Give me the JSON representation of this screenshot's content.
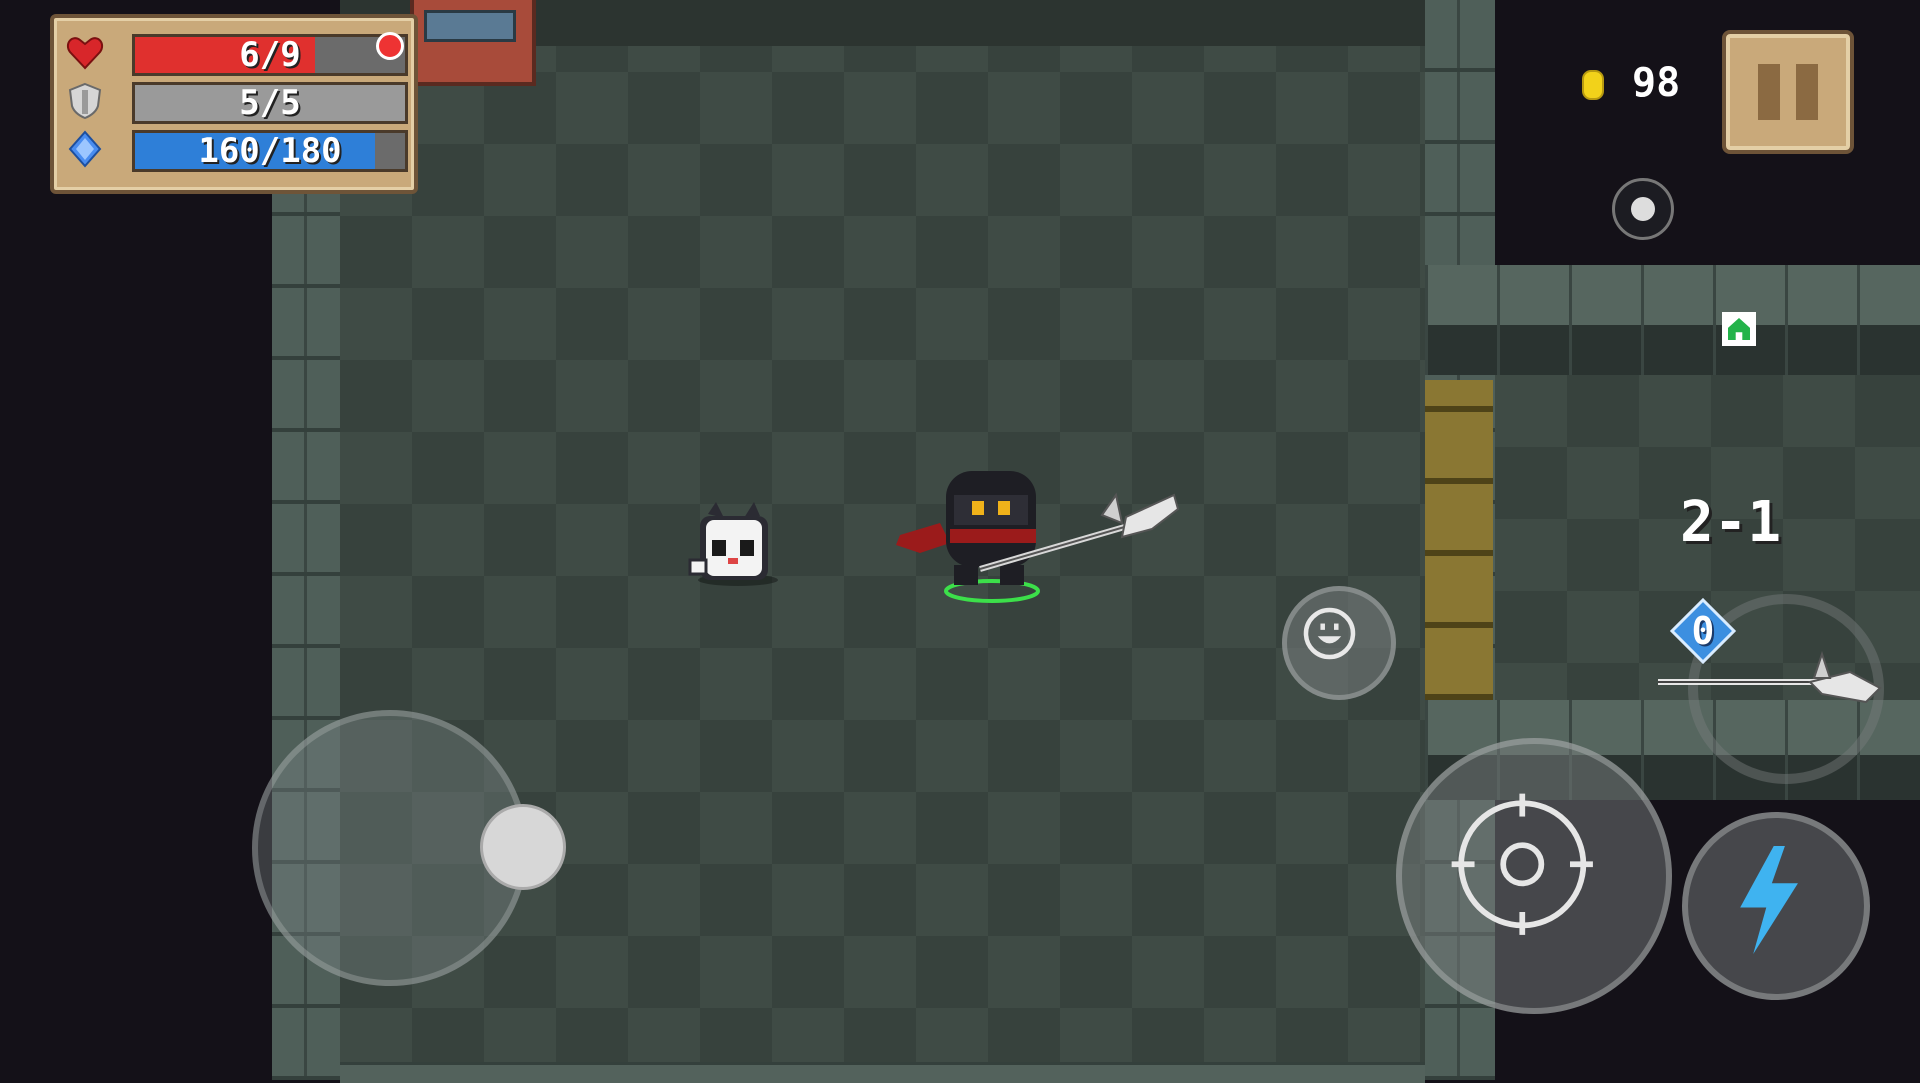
{
  "stats": {
    "health": {
      "label": "6/9",
      "current": 6,
      "max": 9,
      "color": "#e0302e"
    },
    "armor": {
      "label": "5/5",
      "current": 5,
      "max": 5,
      "color": "#9a9a9a"
    },
    "energy": {
      "label": "160/180",
      "current": 160,
      "max": 180,
      "color": "#2e7fd8"
    }
  },
  "coins": {
    "count": "98"
  },
  "level": {
    "label": "2-1"
  },
  "weapon": {
    "energy_cost": "0"
  },
  "icons": {
    "health": "heart-icon",
    "armor": "shield-icon",
    "energy": "energy-crystal-icon",
    "coin": "coin-icon",
    "pause": "pause-icon",
    "record": "record-icon",
    "minimap": "home-icon",
    "emote": "smiley-icon",
    "attack": "crosshair-icon",
    "skill": "lightning-icon",
    "weapon": "halberd-icon"
  },
  "colors": {
    "accent_skill": "#3fb3f0",
    "panel": "#c9a97a"
  }
}
